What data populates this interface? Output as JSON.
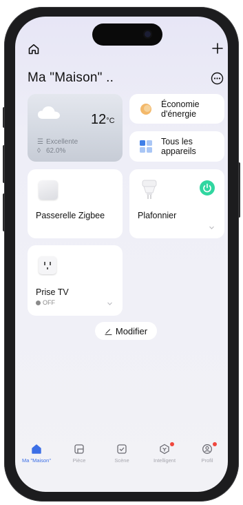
{
  "header": {
    "title": "Ma \"Maison\" .."
  },
  "weather": {
    "temperature": "12",
    "unit": "°C",
    "quality": "Excellente",
    "humidity": "62.0%"
  },
  "tiles": {
    "energy_label": "Économie d'énergie",
    "devices_label": "Tous les appareils"
  },
  "devices": [
    {
      "name": "Passerelle Zigbee"
    },
    {
      "name": "Plafonnier",
      "power": "on"
    },
    {
      "name": "Prise TV",
      "status": "OFF"
    }
  ],
  "modify_label": "Modifier",
  "tabs": [
    {
      "label": "Ma \"Maison\"",
      "active": true
    },
    {
      "label": "Pièce"
    },
    {
      "label": "Scène"
    },
    {
      "label": "Intelligent",
      "badge": true
    },
    {
      "label": "Profil",
      "badge": true
    }
  ],
  "colors": {
    "accent": "#3c6fe6",
    "power_on": "#31d6a0",
    "badge": "#f0473d"
  }
}
